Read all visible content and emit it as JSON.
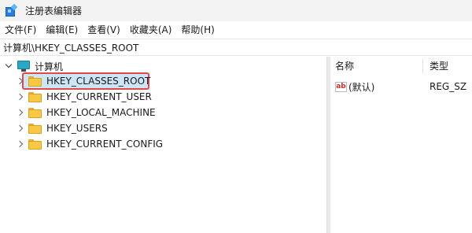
{
  "window": {
    "title": "注册表编辑器"
  },
  "menu": [
    {
      "label": "文件(F)"
    },
    {
      "label": "编辑(E)"
    },
    {
      "label": "查看(V)"
    },
    {
      "label": "收藏夹(A)"
    },
    {
      "label": "帮助(H)"
    }
  ],
  "address": {
    "path": "计算机\\HKEY_CLASSES_ROOT"
  },
  "tree": {
    "root_label": "计算机",
    "items": [
      {
        "label": "HKEY_CLASSES_ROOT",
        "selected": true
      },
      {
        "label": "HKEY_CURRENT_USER"
      },
      {
        "label": "HKEY_LOCAL_MACHINE"
      },
      {
        "label": "HKEY_USERS"
      },
      {
        "label": "HKEY_CURRENT_CONFIG"
      }
    ]
  },
  "values_pane": {
    "columns": [
      {
        "label": "名称"
      },
      {
        "label": "类型"
      }
    ],
    "rows": [
      {
        "name": "(默认)",
        "type": "REG_SZ"
      }
    ]
  },
  "colors": {
    "selection": "#cde6f7",
    "highlight_border": "#e24a4a",
    "folder": "#f8c843"
  }
}
